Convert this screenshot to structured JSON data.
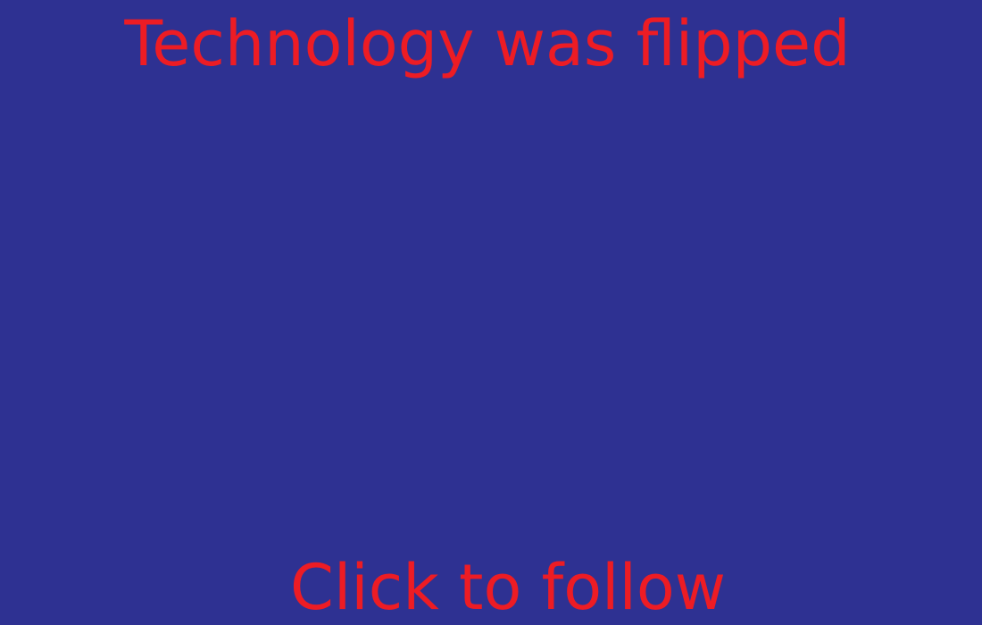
{
  "screen": {
    "headline": "Technology was flipped",
    "follow_label": "Click to follow"
  },
  "colors": {
    "background": "#2e3192",
    "text": "#ed1c24"
  }
}
